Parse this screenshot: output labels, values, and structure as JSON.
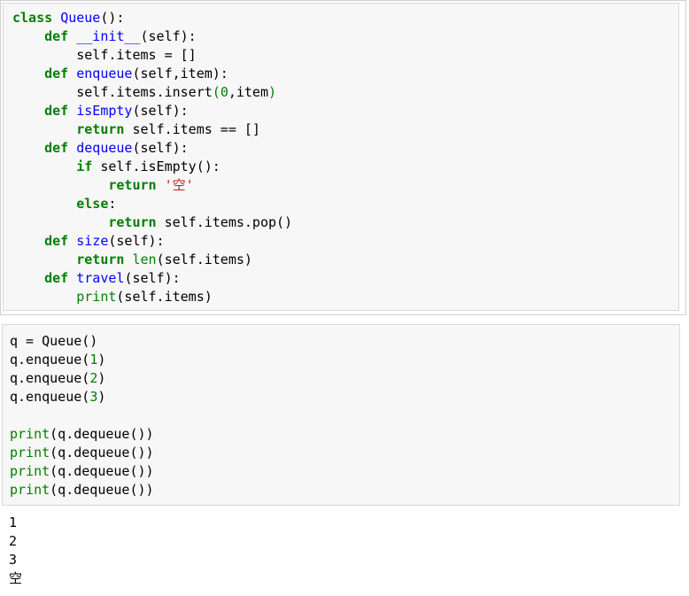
{
  "cell1": {
    "lines": [
      [
        [
          "kw",
          "class"
        ],
        [
          "t",
          " "
        ],
        [
          "fn",
          "Queue"
        ],
        [
          "t",
          "():"
        ]
      ],
      [
        [
          "t",
          "    "
        ],
        [
          "kw",
          "def"
        ],
        [
          "t",
          " "
        ],
        [
          "fn",
          "__init__"
        ],
        [
          "t",
          "(self):"
        ]
      ],
      [
        [
          "t",
          "        self.items = []"
        ]
      ],
      [
        [
          "t",
          "    "
        ],
        [
          "kw",
          "def"
        ],
        [
          "t",
          " "
        ],
        [
          "fn",
          "enqueue"
        ],
        [
          "t",
          "(self,item):"
        ]
      ],
      [
        [
          "t",
          "        self.items.insert"
        ],
        [
          "bi",
          "("
        ],
        [
          "num",
          "0"
        ],
        [
          "t",
          ",item"
        ],
        [
          "bi",
          ")"
        ]
      ],
      [
        [
          "t",
          "    "
        ],
        [
          "kw",
          "def"
        ],
        [
          "t",
          " "
        ],
        [
          "fn",
          "isEmpty"
        ],
        [
          "t",
          "(self):"
        ]
      ],
      [
        [
          "t",
          "        "
        ],
        [
          "kw",
          "return"
        ],
        [
          "t",
          " self.items == []"
        ]
      ],
      [
        [
          "t",
          "    "
        ],
        [
          "kw",
          "def"
        ],
        [
          "t",
          " "
        ],
        [
          "fn",
          "dequeue"
        ],
        [
          "t",
          "(self):"
        ]
      ],
      [
        [
          "t",
          "        "
        ],
        [
          "kw",
          "if"
        ],
        [
          "t",
          " self.isEmpty():"
        ]
      ],
      [
        [
          "t",
          "            "
        ],
        [
          "kw",
          "return"
        ],
        [
          "t",
          " "
        ],
        [
          "str",
          "'空'"
        ]
      ],
      [
        [
          "t",
          "        "
        ],
        [
          "kw",
          "else"
        ],
        [
          "t",
          ":"
        ]
      ],
      [
        [
          "t",
          "            "
        ],
        [
          "kw",
          "return"
        ],
        [
          "t",
          " self.items.pop()"
        ]
      ],
      [
        [
          "t",
          "    "
        ],
        [
          "kw",
          "def"
        ],
        [
          "t",
          " "
        ],
        [
          "fn",
          "size"
        ],
        [
          "t",
          "(self):"
        ]
      ],
      [
        [
          "t",
          "        "
        ],
        [
          "kw",
          "return"
        ],
        [
          "t",
          " "
        ],
        [
          "bi",
          "len"
        ],
        [
          "t",
          "(self.items)"
        ]
      ],
      [
        [
          "t",
          "    "
        ],
        [
          "kw",
          "def"
        ],
        [
          "t",
          " "
        ],
        [
          "fn",
          "travel"
        ],
        [
          "t",
          "(self):"
        ]
      ],
      [
        [
          "t",
          "        "
        ],
        [
          "bi",
          "print"
        ],
        [
          "t",
          "(self.items)"
        ]
      ]
    ]
  },
  "cell2": {
    "lines": [
      [
        [
          "t",
          "q = Queue()"
        ]
      ],
      [
        [
          "t",
          "q.enqueue("
        ],
        [
          "num",
          "1"
        ],
        [
          "t",
          ")"
        ]
      ],
      [
        [
          "t",
          "q.enqueue("
        ],
        [
          "num",
          "2"
        ],
        [
          "t",
          ")"
        ]
      ],
      [
        [
          "t",
          "q.enqueue("
        ],
        [
          "num",
          "3"
        ],
        [
          "t",
          ")"
        ]
      ],
      [
        [
          "t",
          ""
        ]
      ],
      [
        [
          "bi",
          "print"
        ],
        [
          "t",
          "(q.dequeue())"
        ]
      ],
      [
        [
          "bi",
          "print"
        ],
        [
          "t",
          "(q.dequeue())"
        ]
      ],
      [
        [
          "bi",
          "print"
        ],
        [
          "t",
          "(q.dequeue())"
        ]
      ],
      [
        [
          "bi",
          "print"
        ],
        [
          "t",
          "(q.dequeue())"
        ]
      ]
    ]
  },
  "output": {
    "lines": [
      "1",
      "2",
      "3",
      "空"
    ]
  }
}
